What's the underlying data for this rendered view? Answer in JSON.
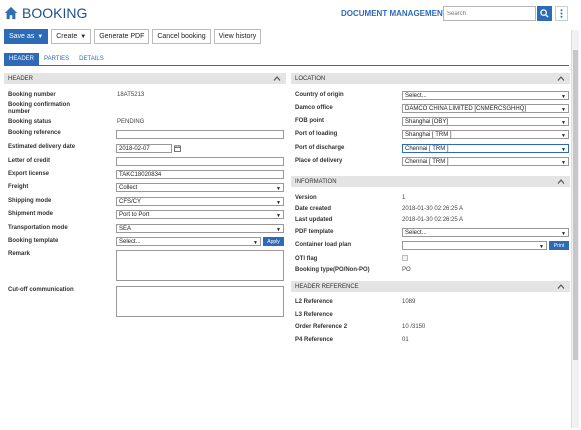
{
  "app": {
    "title": "BOOKING",
    "doc_mgmt": "DOCUMENT MANAGEMENT",
    "search_placeholder": "Search"
  },
  "toolbar": {
    "save_as": "Save as",
    "create": "Create",
    "generate_pdf": "Generate PDF",
    "cancel_booking": "Cancel booking",
    "view_history": "View history"
  },
  "tabs": [
    "HEADER",
    "PARTIES",
    "DETAILS"
  ],
  "header_section": {
    "title": "HEADER",
    "booking_number_label": "Booking number",
    "booking_number": "18AT5213",
    "booking_confirmation_label_1": "Booking confirmation",
    "booking_confirmation_label_2": "number",
    "booking_status_label": "Booking status",
    "booking_status": "PENDING",
    "booking_reference_label": "Booking reference",
    "estimated_delivery_label": "Estimated delivery date",
    "estimated_delivery": "2018-02-07",
    "letter_of_credit_label": "Letter of credit",
    "export_license_label": "Export license",
    "export_license": "TAKC18020834",
    "freight_label": "Freight",
    "freight": "Collect",
    "shipping_mode_label": "Shipping mode",
    "shipping_mode": "CFS/CY",
    "shipment_mode_label": "Shipment mode",
    "shipment_mode": "Port to Port",
    "transportation_mode_label": "Transportation mode",
    "transportation_mode": "SEA",
    "booking_template_label": "Booking template",
    "booking_template": "Select...",
    "apply": "Apply",
    "remark_label": "Remark",
    "cutoff_label": "Cut-off communication"
  },
  "location_section": {
    "title": "LOCATION",
    "country_of_origin_label": "Country of origin",
    "country_of_origin": "Select...",
    "damco_office_label": "Damco office",
    "damco_office": "DAMCO CHINA LIMITED [CNMERCSGHHQ]",
    "fob_point_label": "FOB point",
    "fob_point": "Shanghai [OBY]",
    "port_of_loading_label": "Port of loading",
    "port_of_loading": "Shanghai [ TRM ]",
    "port_of_discharge_label": "Port of discharge",
    "port_of_discharge": "Chennai [ TRM ]",
    "place_of_delivery_label": "Place of delivery",
    "place_of_delivery": "Chennai [ TRM ]"
  },
  "information_section": {
    "title": "INFORMATION",
    "version_label": "Version",
    "version": "1",
    "date_created_label": "Date created",
    "date_created": "2018-01-30 02:26:25 A",
    "last_updated_label": "Last updated",
    "last_updated": "2018-01-30 02:26:25 A",
    "pdf_template_label": "PDF template",
    "pdf_template": "Select...",
    "container_load_plan_label": "Container load plan",
    "print": "Print",
    "oti_flag_label": "OTI flag",
    "booking_type_label": "Booking type(PO/Non-PO)",
    "booking_type": "PO"
  },
  "header_reference_section": {
    "title": "HEADER REFERENCE",
    "l2_label": "L2 Reference",
    "l2": "1089",
    "l3_label": "L3 Reference",
    "order_ref2_label": "Order Reference 2",
    "order_ref2": "10 /3150",
    "p4_label": "P4 Reference",
    "p4": "01"
  }
}
